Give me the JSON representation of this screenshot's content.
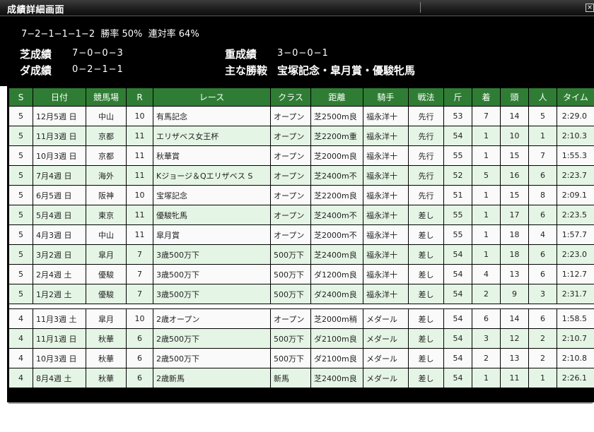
{
  "window": {
    "title": "成績詳細画面",
    "close_label": "×"
  },
  "summary": {
    "record": "7−2−1−1−1−2",
    "win_rate": "勝率 50%",
    "place_rate": "連対率 64%",
    "turf_label": "芝成績",
    "turf_value": "7−0−0−3",
    "dirt_label": "ダ成績",
    "dirt_value": "0−2−1−1",
    "heavy_label": "重成績",
    "heavy_value": "3−0−0−1",
    "main_label": "主な勝鞍",
    "main_value": "宝塚記念・皐月賞・優駿牝馬"
  },
  "table": {
    "headers": [
      "S",
      "日付",
      "競馬場",
      "R",
      "レース",
      "クラス",
      "距離",
      "騎手",
      "戦法",
      "斤",
      "着",
      "頭",
      "人",
      "タイム"
    ],
    "groups": [
      {
        "rows": [
          [
            "5",
            "12月5週 日",
            "中山",
            "10",
            "有馬記念",
            "オープン",
            "芝2500m良",
            "福永洋十",
            "先行",
            "53",
            "7",
            "14",
            "5",
            "2:29.0"
          ],
          [
            "5",
            "11月3週 日",
            "京都",
            "11",
            "エリザベス女王杯",
            "オープン",
            "芝2200m重",
            "福永洋十",
            "先行",
            "54",
            "1",
            "10",
            "1",
            "2:10.3"
          ],
          [
            "5",
            "10月3週 日",
            "京都",
            "11",
            "秋華賞",
            "オープン",
            "芝2000m良",
            "福永洋十",
            "先行",
            "55",
            "1",
            "15",
            "7",
            "1:55.3"
          ],
          [
            "5",
            "7月4週 日",
            "海外",
            "11",
            "Kジョージ＆Qエリザベス S",
            "オープン",
            "芝2400m不",
            "福永洋十",
            "先行",
            "52",
            "5",
            "16",
            "6",
            "2:23.7"
          ],
          [
            "5",
            "6月5週 日",
            "阪神",
            "10",
            "宝塚記念",
            "オープン",
            "芝2200m良",
            "福永洋十",
            "先行",
            "51",
            "1",
            "15",
            "8",
            "2:09.1"
          ],
          [
            "5",
            "5月4週 日",
            "東京",
            "11",
            "優駿牝馬",
            "オープン",
            "芝2400m不",
            "福永洋十",
            "差し",
            "55",
            "1",
            "17",
            "6",
            "2:23.5"
          ],
          [
            "5",
            "4月3週 日",
            "中山",
            "11",
            "皐月賞",
            "オープン",
            "芝2000m不",
            "福永洋十",
            "差し",
            "55",
            "1",
            "18",
            "4",
            "1:57.7"
          ],
          [
            "5",
            "3月2週 日",
            "皐月",
            "7",
            "3歳500万下",
            "500万下",
            "芝2400m良",
            "福永洋十",
            "差し",
            "54",
            "1",
            "18",
            "6",
            "2:23.0"
          ],
          [
            "5",
            "2月4週 土",
            "優駿",
            "7",
            "3歳500万下",
            "500万下",
            "ダ1200m良",
            "福永洋十",
            "差し",
            "54",
            "4",
            "13",
            "6",
            "1:12.7"
          ],
          [
            "5",
            "1月2週 土",
            "優駿",
            "7",
            "3歳500万下",
            "500万下",
            "ダ2400m良",
            "福永洋十",
            "差し",
            "54",
            "2",
            "9",
            "3",
            "2:31.7"
          ]
        ]
      },
      {
        "rows": [
          [
            "4",
            "11月3週 土",
            "皐月",
            "10",
            "2歳オープン",
            "オープン",
            "芝2000m稍",
            "メダール",
            "差し",
            "54",
            "6",
            "14",
            "6",
            "1:58.5"
          ],
          [
            "4",
            "11月1週 日",
            "秋華",
            "6",
            "2歳500万下",
            "500万下",
            "ダ2100m良",
            "メダール",
            "差し",
            "54",
            "3",
            "12",
            "2",
            "2:10.7"
          ],
          [
            "4",
            "10月3週 日",
            "秋華",
            "6",
            "2歳500万下",
            "500万下",
            "ダ2100m良",
            "メダール",
            "差し",
            "54",
            "2",
            "13",
            "2",
            "2:10.8"
          ],
          [
            "4",
            "8月4週 土",
            "秋華",
            "6",
            "2歳新馬",
            "新馬",
            "芝2400m良",
            "メダール",
            "差し",
            "54",
            "1",
            "11",
            "1",
            "2:26.1"
          ]
        ]
      }
    ]
  },
  "colors": {
    "header_bg": "#2f7d34",
    "row_light": "#fafafa",
    "row_green": "#e5f5e5",
    "panel_bg": "#000000"
  }
}
